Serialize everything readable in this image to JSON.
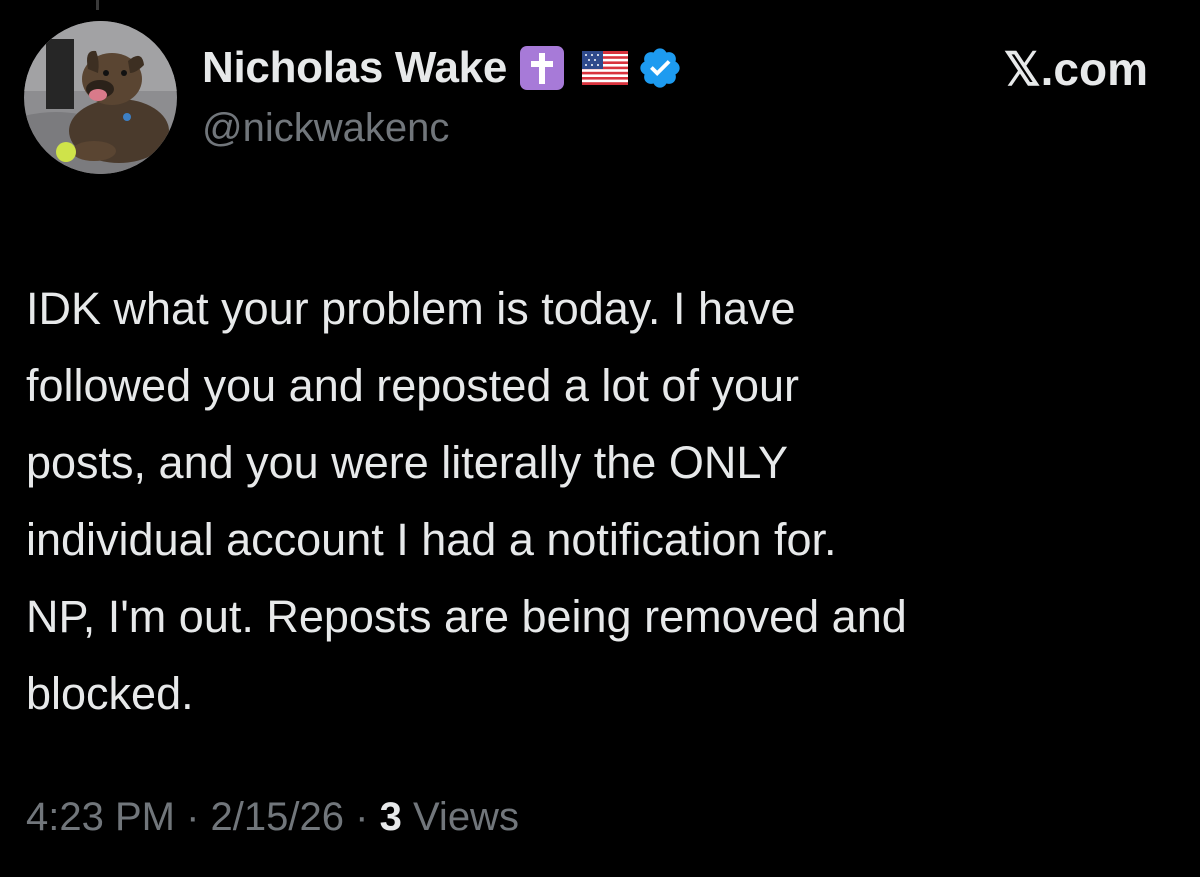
{
  "author": {
    "display_name": "Nicholas Wake",
    "handle": "@nickwakenc",
    "badges": [
      "latin-cross-emoji",
      "us-flag-emoji",
      "verified-badge-icon"
    ]
  },
  "brand": {
    "label": "𝕏.com"
  },
  "tweet": {
    "lines": [
      "IDK what your problem is today. I have",
      "followed you and reposted a lot of your",
      "posts, and you were literally the ONLY",
      "individual account I had a notification for.",
      "NP, I'm out. Reposts are being removed and",
      "blocked."
    ]
  },
  "meta": {
    "time": "4:23 PM",
    "separator": "·",
    "date": "2/15/26",
    "views_count": "3",
    "views_label": "Views"
  },
  "colors": {
    "background": "#000000",
    "text": "#e7e9ea",
    "secondary_text": "#71767b",
    "verified_blue": "#1d9bf0",
    "cross_purple": "#a77ad8"
  }
}
